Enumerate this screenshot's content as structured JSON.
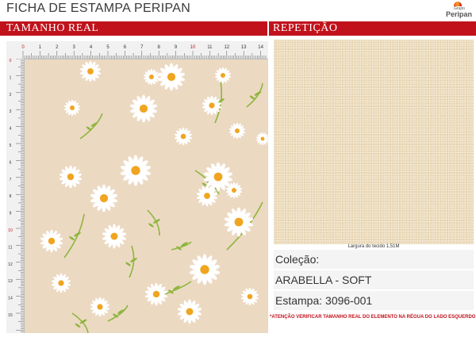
{
  "header": {
    "title": "FICHA DE ESTAMPA PERIPAN",
    "logo_small": "Grupo",
    "logo_brand": "Peripan"
  },
  "sections": {
    "left_title": "TAMANHO REAL",
    "right_title": "REPETIÇÃO"
  },
  "ruler": {
    "top_labels": [
      "0",
      "1",
      "2",
      "3",
      "4",
      "5",
      "6",
      "7",
      "8",
      "9",
      "10",
      "11",
      "12",
      "13",
      "14"
    ],
    "left_labels": [
      "0",
      "1",
      "2",
      "3",
      "4",
      "5",
      "6",
      "7",
      "8",
      "9",
      "10",
      "11",
      "12",
      "13",
      "14",
      "15",
      "16"
    ]
  },
  "repeat": {
    "width_label": "Largura do tecido 1,51M"
  },
  "info": {
    "collection_label": "Coleção:",
    "collection_name": "ARABELLA - SOFT",
    "print_code": "Estampa: 3096-001"
  },
  "warning": "*ATENÇÃO VERIFICAR TAMANHO REAL DO ELEMENTO NA RÉGUA DO LADO ESQUERDO",
  "colors": {
    "accent_red": "#c1121c",
    "pattern_background": "#ecd9c2",
    "daisy_petal": "#ffffff",
    "daisy_center": "#f0a520",
    "stem": "#8db63c"
  }
}
